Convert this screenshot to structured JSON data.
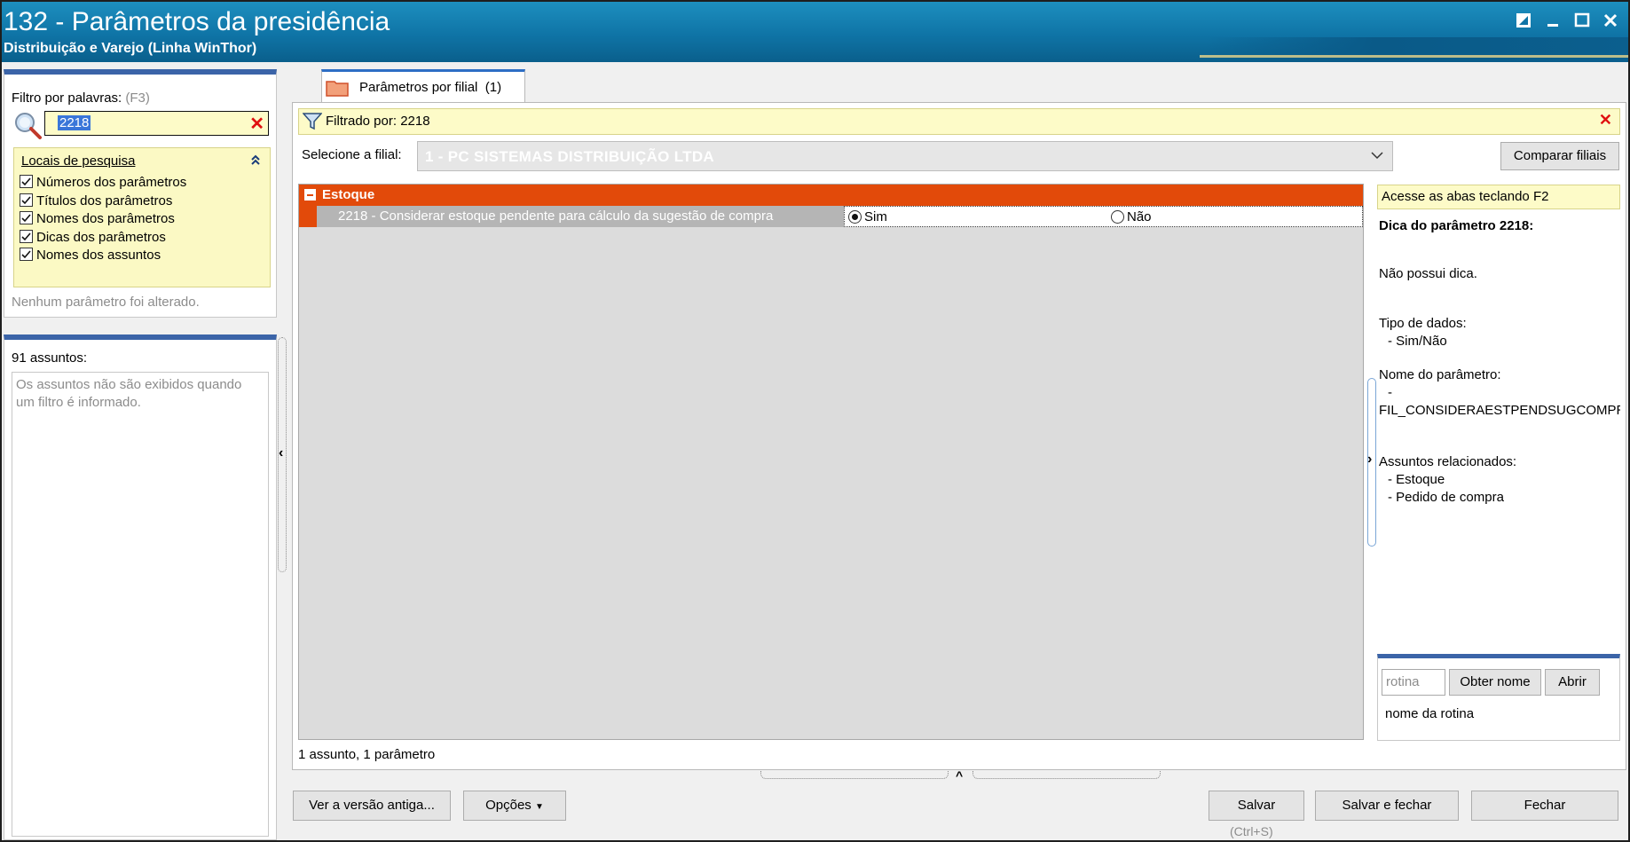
{
  "window": {
    "title": "132 - Parâmetros da presidência",
    "subtitle": "Distribuição e Varejo (Linha WinThor)"
  },
  "filter": {
    "label": "Filtro por palavras:",
    "shortcut": "(F3)",
    "value": "2218",
    "locais": {
      "title": "Locais de pesquisa",
      "items": [
        {
          "label": "Números dos parâmetros",
          "checked": true
        },
        {
          "label": "Títulos dos parâmetros",
          "checked": true
        },
        {
          "label": "Nomes dos parâmetros",
          "checked": true
        },
        {
          "label": "Dicas dos parâmetros",
          "checked": true
        },
        {
          "label": "Nomes dos assuntos",
          "checked": true
        }
      ]
    },
    "status": "Nenhum parâmetro foi alterado."
  },
  "assuntos": {
    "label": "91 assuntos:",
    "message_line1": "Os assuntos não são exibidos quando",
    "message_line2": "um filtro é informado."
  },
  "tab": {
    "label": "Parâmetros por filial",
    "count": "(1)"
  },
  "filtered_by": "Filtrado por: 2218",
  "branch": {
    "label": "Selecione a filial:",
    "value": "1 - PC SISTEMAS DISTRIBUIÇÃO LTDA",
    "compare_button": "Comparar filiais"
  },
  "grid": {
    "group": "Estoque",
    "rows": [
      {
        "description": "2218 - Considerar estoque pendente para cálculo da sugestão de compra",
        "option_yes": "Sim",
        "option_no": "Não",
        "selected": "Sim"
      }
    ],
    "summary": "1 assunto, 1 parâmetro"
  },
  "hint": {
    "tip": "Acesse as abas teclando F2",
    "title": "Dica do parâmetro 2218:",
    "no_hint": "Não possui dica.",
    "data_type_label": "Tipo de dados:",
    "data_type_value": "- Sim/Não",
    "param_name_label": "Nome do parâmetro:",
    "param_name_dash": "-",
    "param_name_value": "FIL_CONSIDERAESTPENDSUGCOMPR.",
    "related_label": "Assuntos relacionados:",
    "related": [
      "- Estoque",
      "- Pedido de compra"
    ]
  },
  "rotina": {
    "placeholder": "rotina",
    "get_name_button": "Obter nome",
    "open_button": "Abrir",
    "name_label": "nome da rotina"
  },
  "footer": {
    "old_version_button": "Ver a versão antiga...",
    "options_button": "Opções",
    "save_button": "Salvar",
    "save_shortcut": "(Ctrl+S)",
    "save_close_button": "Salvar e fechar",
    "close_button": "Fechar"
  },
  "colors": {
    "title_bar": "#0f74a6",
    "group_header": "#e24a0a",
    "hint_background": "#fdfbc8",
    "selection": "#3a76d9",
    "panel_accent": "#3b64a8"
  }
}
